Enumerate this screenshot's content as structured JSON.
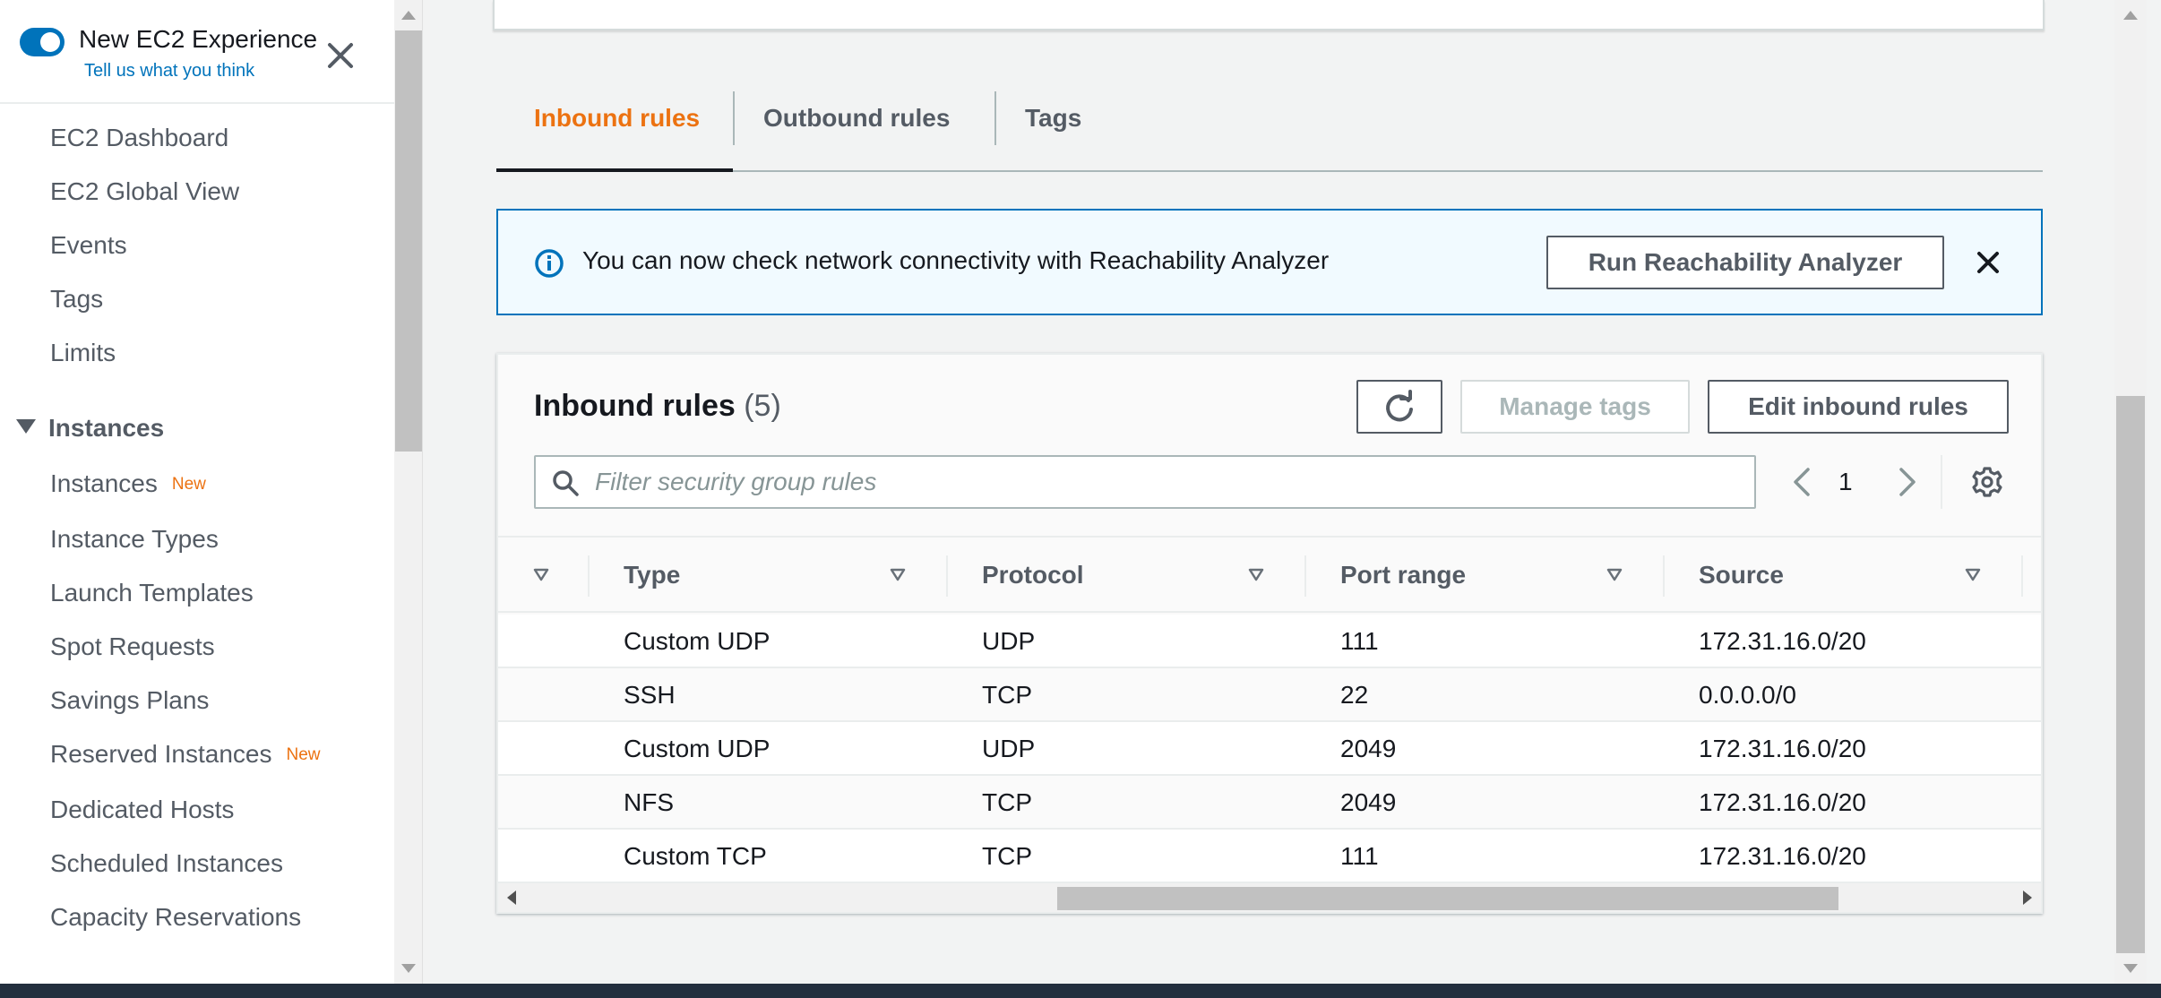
{
  "experience": {
    "toggle_on": true,
    "title": "New EC2 Experience",
    "feedback_link": "Tell us what you think"
  },
  "sidebar": {
    "items_top": [
      {
        "label": "EC2 Dashboard"
      },
      {
        "label": "EC2 Global View"
      },
      {
        "label": "Events"
      },
      {
        "label": "Tags"
      },
      {
        "label": "Limits"
      }
    ],
    "section": {
      "label": "Instances",
      "expanded": true
    },
    "section_items": [
      {
        "label": "Instances",
        "badge": "New"
      },
      {
        "label": "Instance Types"
      },
      {
        "label": "Launch Templates"
      },
      {
        "label": "Spot Requests"
      },
      {
        "label": "Savings Plans"
      },
      {
        "label": "Reserved Instances",
        "badge": "New"
      },
      {
        "label": "Dedicated Hosts"
      },
      {
        "label": "Scheduled Instances"
      },
      {
        "label": "Capacity Reservations"
      }
    ]
  },
  "tabs": [
    {
      "label": "Inbound rules",
      "active": true
    },
    {
      "label": "Outbound rules",
      "active": false
    },
    {
      "label": "Tags",
      "active": false
    }
  ],
  "flash": {
    "message": "You can now check network connectivity with Reachability Analyzer",
    "button": "Run Reachability Analyzer"
  },
  "panel": {
    "title": "Inbound rules",
    "count": "(5)",
    "manage_tags": "Manage tags",
    "edit_rules": "Edit inbound rules",
    "search_placeholder": "Filter security group rules",
    "page": "1"
  },
  "table": {
    "columns": [
      "Type",
      "Protocol",
      "Port range",
      "Source"
    ],
    "rows": [
      [
        "Custom UDP",
        "UDP",
        "111",
        "172.31.16.0/20"
      ],
      [
        "SSH",
        "TCP",
        "22",
        "0.0.0.0/0"
      ],
      [
        "Custom UDP",
        "UDP",
        "2049",
        "172.31.16.0/20"
      ],
      [
        "NFS",
        "TCP",
        "2049",
        "172.31.16.0/20"
      ],
      [
        "Custom TCP",
        "TCP",
        "111",
        "172.31.16.0/20"
      ]
    ]
  },
  "colors": {
    "accent_orange": "#ec7211",
    "link_blue": "#0073bb",
    "text_dark": "#16191f",
    "text_gray": "#545b64",
    "info_bg": "#f1faff"
  }
}
